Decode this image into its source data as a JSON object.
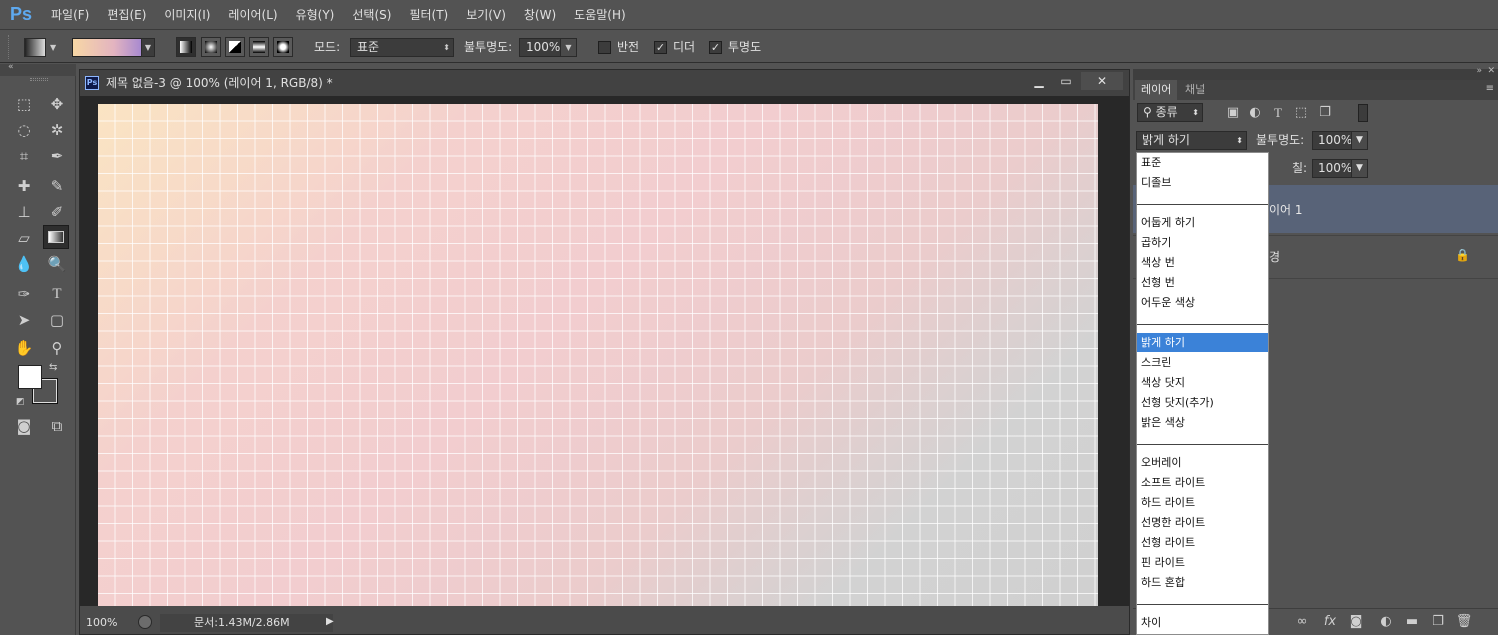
{
  "app": {
    "logo": "Ps"
  },
  "menu": [
    "파일(F)",
    "편집(E)",
    "이미지(I)",
    "레이어(L)",
    "유형(Y)",
    "선택(S)",
    "필터(T)",
    "보기(V)",
    "창(W)",
    "도움말(H)"
  ],
  "options": {
    "mode_label": "모드:",
    "mode_value": "표준",
    "opacity_label": "불투명도:",
    "opacity_value": "100%",
    "reverse_label": "반전",
    "dither_label": "디더",
    "transparency_label": "투명도",
    "reverse_checked": false,
    "dither_checked": true,
    "transparency_checked": true
  },
  "document": {
    "title": "제목 없음-3 @ 100% (레이어 1, RGB/8) *",
    "zoom": "100%",
    "status": "문서:1.43M/2.86M",
    "gradient_colors": [
      "#fae4c3",
      "#f2cdcf",
      "#d0d0d0"
    ]
  },
  "layers_panel": {
    "tabs": [
      "레이어",
      "채널"
    ],
    "filter_kind": "종류",
    "blend_mode": "밝게 하기",
    "opacity_label": "불투명도:",
    "opacity_value": "100%",
    "fill_label": "칠:",
    "fill_value": "100%",
    "layer1_name": "이어 1",
    "layer2_fragment": "경"
  },
  "blend_dropdown": {
    "groups": [
      [
        "표준",
        "디졸브"
      ],
      [
        "어둡게 하기",
        "곱하기",
        "색상 번",
        "선형 번",
        "어두운 색상"
      ],
      [
        "밝게 하기",
        "스크린",
        "색상 닷지",
        "선형 닷지(추가)",
        "밝은 색상"
      ],
      [
        "오버레이",
        "소프트 라이트",
        "하드 라이트",
        "선명한 라이트",
        "선형 라이트",
        "핀 라이트",
        "하드 혼합"
      ],
      [
        "차이"
      ]
    ],
    "selected": "밝게 하기",
    "selected_color": "#3b82d8"
  },
  "colors": {
    "foreground": "#ffffff",
    "background": "#535353"
  }
}
